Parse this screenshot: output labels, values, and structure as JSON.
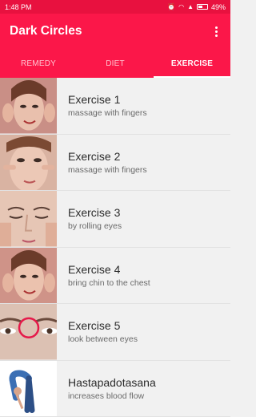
{
  "status": {
    "time": "1:48 PM",
    "battery": "49%"
  },
  "app": {
    "title": "Dark Circles"
  },
  "tabs": [
    {
      "label": "REMEDY",
      "active": false
    },
    {
      "label": "DIET",
      "active": false
    },
    {
      "label": "EXERCISE",
      "active": true
    }
  ],
  "exercises": [
    {
      "title": "Exercise 1",
      "subtitle": "massage with fingers"
    },
    {
      "title": "Exercise 2",
      "subtitle": "massage with fingers"
    },
    {
      "title": "Exercise 3",
      "subtitle": "by rolling eyes"
    },
    {
      "title": "Exercise 4",
      "subtitle": "bring chin to the chest"
    },
    {
      "title": "Exercise 5",
      "subtitle": "look between eyes"
    },
    {
      "title": "Hastapadotasana",
      "subtitle": "increases blood flow"
    }
  ],
  "colors": {
    "accent": "#fb1749",
    "status_bar": "#e8113f"
  }
}
